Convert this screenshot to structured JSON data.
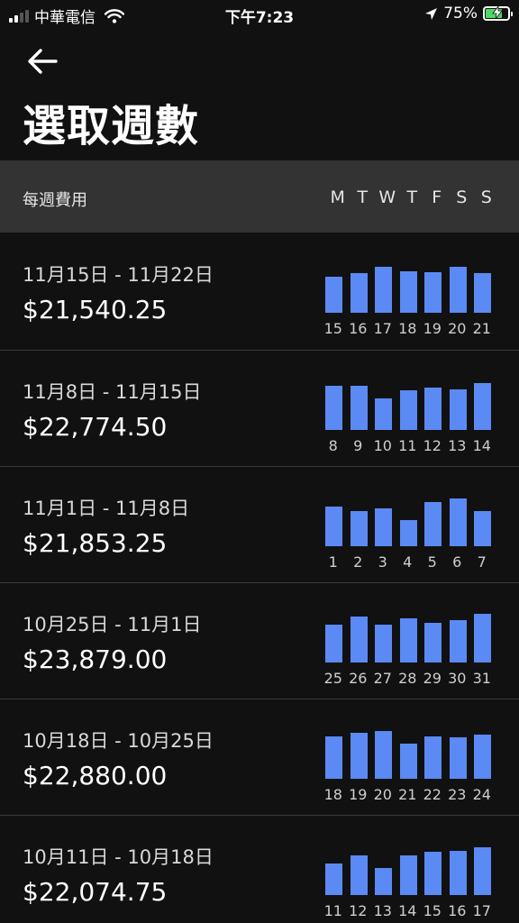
{
  "status_bar": {
    "carrier": "中華電信",
    "time": "下午7:23",
    "battery": "75%",
    "battery_level": 0.75,
    "battery_color": "#4cd964"
  },
  "nav": {
    "back_icon": "arrow-left-icon",
    "title": "選取週數"
  },
  "header": {
    "label": "每週費用",
    "day_letters": [
      "M",
      "T",
      "W",
      "T",
      "F",
      "S",
      "S"
    ]
  },
  "accent_color": "#5b8af5",
  "weeks": [
    {
      "range": "11月15日 - 11月22日",
      "amount": "$21,540.25",
      "days": [
        "15",
        "16",
        "17",
        "18",
        "19",
        "20",
        "21"
      ],
      "bar_levels": [
        0.67,
        0.73,
        0.85,
        0.77,
        0.75,
        0.85,
        0.73
      ]
    },
    {
      "range": "11月8日 - 11月15日",
      "amount": "$22,774.50",
      "days": [
        "8",
        "9",
        "10",
        "11",
        "12",
        "13",
        "14"
      ],
      "bar_levels": [
        0.82,
        0.82,
        0.58,
        0.73,
        0.78,
        0.75,
        0.87
      ]
    },
    {
      "range": "11月1日 - 11月8日",
      "amount": "$21,853.25",
      "days": [
        "1",
        "2",
        "3",
        "4",
        "5",
        "6",
        "7"
      ],
      "bar_levels": [
        0.73,
        0.65,
        0.7,
        0.48,
        0.82,
        0.88,
        0.65
      ]
    },
    {
      "range": "10月25日 - 11月1日",
      "amount": "$23,879.00",
      "days": [
        "25",
        "26",
        "27",
        "28",
        "29",
        "30",
        "31"
      ],
      "bar_levels": [
        0.7,
        0.85,
        0.7,
        0.82,
        0.73,
        0.78,
        0.9
      ]
    },
    {
      "range": "10月18日 - 10月25日",
      "amount": "$22,880.00",
      "days": [
        "18",
        "19",
        "20",
        "21",
        "22",
        "23",
        "24"
      ],
      "bar_levels": [
        0.78,
        0.85,
        0.88,
        0.65,
        0.78,
        0.77,
        0.82
      ]
    },
    {
      "range": "10月11日 - 10月18日",
      "amount": "$22,074.75",
      "days": [
        "11",
        "12",
        "13",
        "14",
        "15",
        "16",
        "17"
      ],
      "bar_levels": [
        0.58,
        0.73,
        0.5,
        0.73,
        0.8,
        0.82,
        0.88
      ]
    }
  ]
}
